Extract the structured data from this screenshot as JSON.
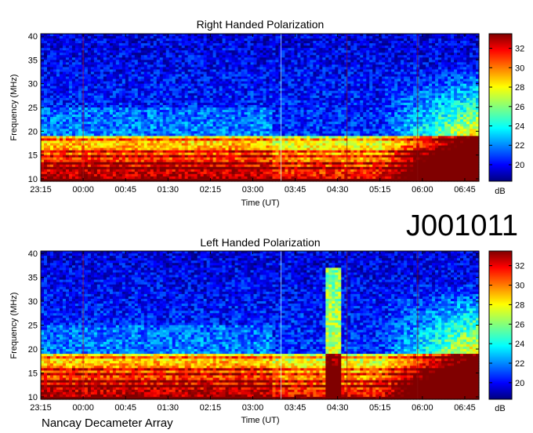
{
  "observation_id": "J001011",
  "footer": "Nancay Decameter Array",
  "chart_data": [
    {
      "type": "heatmap",
      "title": "Right Handed Polarization",
      "xlabel": "Time (UT)",
      "ylabel": "Frequency (MHz)",
      "x_tick_labels": [
        "23:15",
        "00:00",
        "00:45",
        "01:30",
        "02:15",
        "03:00",
        "03:45",
        "04:30",
        "05:15",
        "06:00",
        "06:45"
      ],
      "x_range_minutes": [
        -45,
        420
      ],
      "y_ticks": [
        10,
        15,
        20,
        25,
        30,
        35,
        40
      ],
      "ylim": [
        9.5,
        40.5
      ],
      "colorbar": {
        "unit": "dB",
        "ticks": [
          20,
          22,
          24,
          26,
          28,
          30,
          32
        ],
        "range": [
          18.3,
          33.5
        ]
      },
      "features": {
        "low_freq_intense_band_mhz": [
          10,
          19
        ],
        "late_broadband_emission_start": "05:15"
      }
    },
    {
      "type": "heatmap",
      "title": "Left Handed Polarization",
      "xlabel": "Time (UT)",
      "ylabel": "Frequency (MHz)",
      "x_tick_labels": [
        "23:15",
        "00:00",
        "00:45",
        "01:30",
        "02:15",
        "03:00",
        "03:45",
        "04:30",
        "05:15",
        "06:00",
        "06:45"
      ],
      "x_range_minutes": [
        -45,
        420
      ],
      "y_ticks": [
        10,
        15,
        20,
        25,
        30,
        35,
        40
      ],
      "ylim": [
        9.5,
        40.5
      ],
      "colorbar": {
        "unit": "dB",
        "ticks": [
          20,
          22,
          24,
          26,
          28,
          30,
          32
        ],
        "range": [
          18.3,
          33.5
        ]
      },
      "features": {
        "low_freq_intense_band_mhz": [
          10,
          19
        ],
        "burst_time": "04:25",
        "late_broadband_emission_start": "05:15"
      }
    }
  ]
}
